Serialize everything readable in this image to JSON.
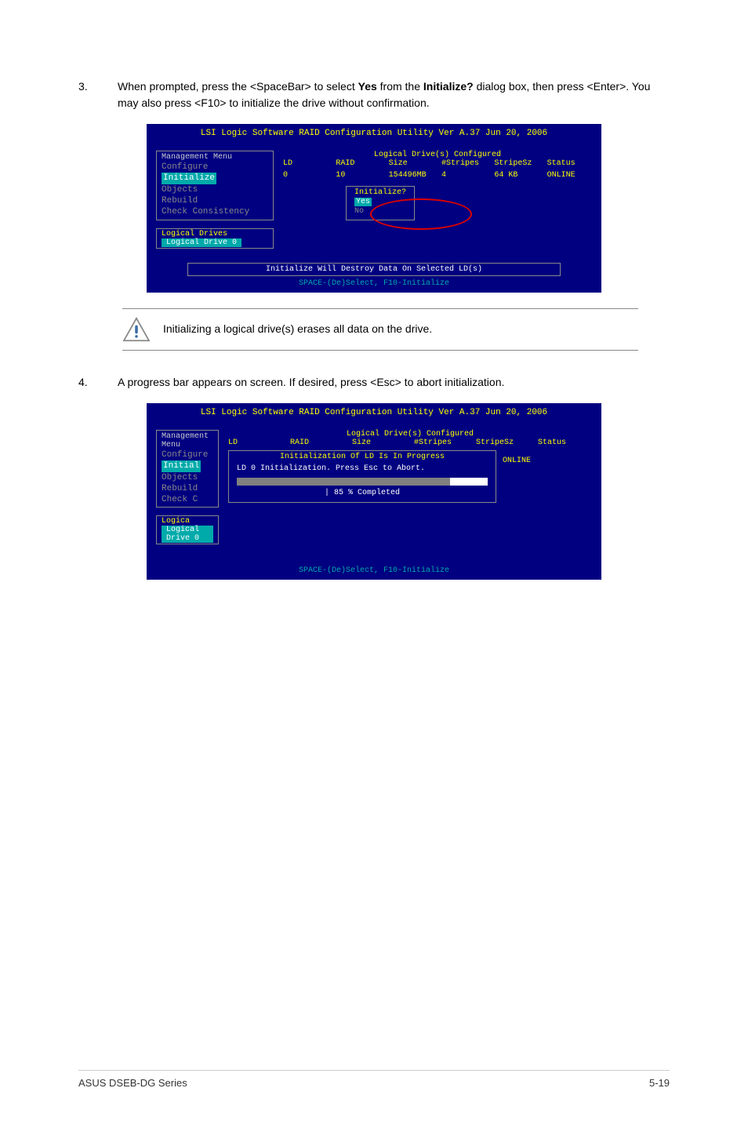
{
  "step3": {
    "num": "3.",
    "text_1": "When prompted, press the <SpaceBar> to select ",
    "bold_1": "Yes",
    "text_2": " from the ",
    "bold_2": "Initialize?",
    "text_3": " dialog box, then press <Enter>. You may also press <F10> to initialize the drive without confirmation."
  },
  "bios1": {
    "title": "LSI Logic Software RAID Configuration Utility Ver A.37 Jun 20, 2006",
    "menu_title": "Management Menu",
    "menu": [
      "Configure",
      "Initialize",
      "Objects",
      "Rebuild",
      "Check Consistency"
    ],
    "menu_hl_index": 1,
    "section_title": "Logical Drive(s) Configured",
    "cols": [
      "LD",
      "RAID",
      "Size",
      "#Stripes",
      "StripeSz",
      "Status"
    ],
    "row": [
      "0",
      "10",
      "154496MB",
      "4",
      "64  KB",
      "ONLINE"
    ],
    "dialog_title": "Initialize?",
    "dialog_opts": [
      "Yes",
      "No"
    ],
    "dialog_sel_index": 0,
    "logical_label": "Logical Drives",
    "logical_sel": "Logical Drive 0",
    "warn": "Initialize Will Destroy Data On Selected LD(s)",
    "footer": "SPACE-(De)Select,  F10-Initialize"
  },
  "note": "Initializing a logical drive(s) erases all data on the drive.",
  "step4": {
    "num": "4.",
    "text": "A progress bar appears on screen. If desired, press <Esc> to abort initialization."
  },
  "bios2": {
    "title": "LSI Logic Software RAID Configuration Utility Ver A.37 Jun 20, 2006",
    "menu_title": "Management Menu",
    "menu": [
      "Configure",
      "Initial",
      "Objects",
      "Rebuild",
      "Check C"
    ],
    "menu_hl_index": 1,
    "section_title": "Logical Drive(s) Configured",
    "cols": [
      "LD",
      "RAID",
      "Size",
      "#Stripes",
      "StripeSz",
      "Status"
    ],
    "progress_title": "Initialization Of LD Is In Progress",
    "progress_msg": "LD 0 Initialization. Press Esc to Abort.",
    "progress_pct": "| 85 % Completed",
    "status": "ONLINE",
    "logical_label": "Logica",
    "logical_sel": "Logical Drive 0",
    "footer": "SPACE-(De)Select,  F10-Initialize"
  },
  "footer": {
    "left": "ASUS DSEB-DG Series",
    "right": "5-19"
  },
  "chart_data": {
    "type": "table",
    "title": "Logical Drive(s) Configured",
    "columns": [
      "LD",
      "RAID",
      "Size",
      "#Stripes",
      "StripeSz",
      "Status"
    ],
    "rows": [
      [
        "0",
        "10",
        "154496MB",
        "4",
        "64 KB",
        "ONLINE"
      ]
    ],
    "progress_percent": 85
  }
}
